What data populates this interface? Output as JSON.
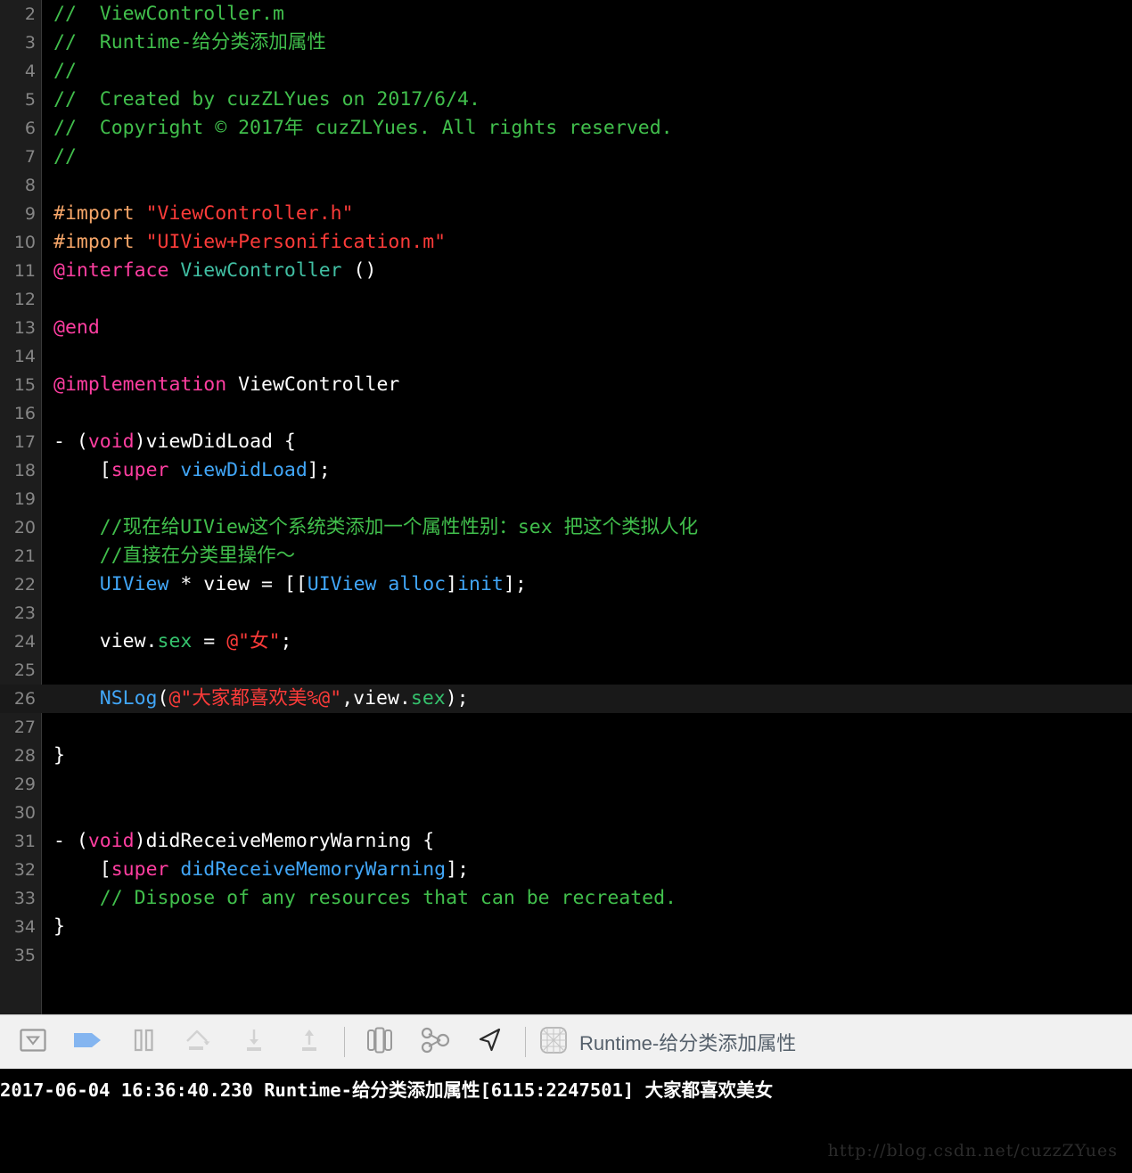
{
  "editor": {
    "first_visible_line": 2,
    "highlighted_line": 26,
    "lines": [
      {
        "n": "2",
        "tokens": [
          {
            "t": "//  ViewController.m",
            "c": "c-comment"
          }
        ]
      },
      {
        "n": "3",
        "tokens": [
          {
            "t": "//  Runtime-给分类添加属性",
            "c": "c-comment"
          }
        ]
      },
      {
        "n": "4",
        "tokens": [
          {
            "t": "//",
            "c": "c-comment"
          }
        ]
      },
      {
        "n": "5",
        "tokens": [
          {
            "t": "//  Created by cuzZLYues on 2017/6/4.",
            "c": "c-comment"
          }
        ]
      },
      {
        "n": "6",
        "tokens": [
          {
            "t": "//  Copyright © 2017年 cuzZLYues. All rights reserved.",
            "c": "c-comment"
          }
        ]
      },
      {
        "n": "7",
        "tokens": [
          {
            "t": "//",
            "c": "c-comment"
          }
        ]
      },
      {
        "n": "8",
        "tokens": []
      },
      {
        "n": "9",
        "tokens": [
          {
            "t": "#import ",
            "c": "c-pre"
          },
          {
            "t": "\"ViewController.h\"",
            "c": "c-string"
          }
        ]
      },
      {
        "n": "10",
        "tokens": [
          {
            "t": "#import ",
            "c": "c-pre"
          },
          {
            "t": "\"UIView+Personification.m\"",
            "c": "c-string"
          }
        ]
      },
      {
        "n": "11",
        "tokens": [
          {
            "t": "@interface ",
            "c": "c-key"
          },
          {
            "t": "ViewController",
            "c": "c-type"
          },
          {
            "t": " ()",
            "c": "c-plain"
          }
        ]
      },
      {
        "n": "12",
        "tokens": []
      },
      {
        "n": "13",
        "tokens": [
          {
            "t": "@end",
            "c": "c-key"
          }
        ]
      },
      {
        "n": "14",
        "tokens": []
      },
      {
        "n": "15",
        "tokens": [
          {
            "t": "@implementation ",
            "c": "c-key"
          },
          {
            "t": "ViewController",
            "c": "c-plain"
          }
        ]
      },
      {
        "n": "16",
        "tokens": []
      },
      {
        "n": "17",
        "tokens": [
          {
            "t": "- (",
            "c": "c-plain"
          },
          {
            "t": "void",
            "c": "c-key"
          },
          {
            "t": ")viewDidLoad {",
            "c": "c-plain"
          }
        ]
      },
      {
        "n": "18",
        "tokens": [
          {
            "t": "    [",
            "c": "c-plain"
          },
          {
            "t": "super ",
            "c": "c-key"
          },
          {
            "t": "viewDidLoad",
            "c": "c-method"
          },
          {
            "t": "];",
            "c": "c-plain"
          }
        ]
      },
      {
        "n": "19",
        "tokens": []
      },
      {
        "n": "20",
        "tokens": [
          {
            "t": "    //现在给UIView这个系统类添加一个属性性别：sex 把这个类拟人化",
            "c": "c-comment"
          }
        ]
      },
      {
        "n": "21",
        "tokens": [
          {
            "t": "    //直接在分类里操作～",
            "c": "c-comment"
          }
        ]
      },
      {
        "n": "22",
        "tokens": [
          {
            "t": "    ",
            "c": "c-plain"
          },
          {
            "t": "UIView",
            "c": "c-class"
          },
          {
            "t": " * view = [[",
            "c": "c-plain"
          },
          {
            "t": "UIView alloc",
            "c": "c-class"
          },
          {
            "t": "]",
            "c": "c-plain"
          },
          {
            "t": "init",
            "c": "c-class"
          },
          {
            "t": "];",
            "c": "c-plain"
          }
        ]
      },
      {
        "n": "23",
        "tokens": []
      },
      {
        "n": "24",
        "tokens": [
          {
            "t": "    view.",
            "c": "c-plain"
          },
          {
            "t": "sex",
            "c": "c-prop"
          },
          {
            "t": " = ",
            "c": "c-plain"
          },
          {
            "t": "@\"女\"",
            "c": "c-string"
          },
          {
            "t": ";",
            "c": "c-plain"
          }
        ]
      },
      {
        "n": "25",
        "tokens": []
      },
      {
        "n": "26",
        "tokens": [
          {
            "t": "    ",
            "c": "c-plain"
          },
          {
            "t": "NSLog",
            "c": "c-class"
          },
          {
            "t": "(",
            "c": "c-plain"
          },
          {
            "t": "@\"大家都喜欢美%@\"",
            "c": "c-string"
          },
          {
            "t": ",view.",
            "c": "c-plain"
          },
          {
            "t": "sex",
            "c": "c-prop"
          },
          {
            "t": ");",
            "c": "c-plain"
          }
        ]
      },
      {
        "n": "27",
        "tokens": []
      },
      {
        "n": "28",
        "tokens": [
          {
            "t": "}",
            "c": "c-plain"
          }
        ]
      },
      {
        "n": "29",
        "tokens": []
      },
      {
        "n": "30",
        "tokens": []
      },
      {
        "n": "31",
        "tokens": [
          {
            "t": "- (",
            "c": "c-plain"
          },
          {
            "t": "void",
            "c": "c-key"
          },
          {
            "t": ")didReceiveMemoryWarning {",
            "c": "c-plain"
          }
        ]
      },
      {
        "n": "32",
        "tokens": [
          {
            "t": "    [",
            "c": "c-plain"
          },
          {
            "t": "super ",
            "c": "c-key"
          },
          {
            "t": "didReceiveMemoryWarning",
            "c": "c-method"
          },
          {
            "t": "];",
            "c": "c-plain"
          }
        ]
      },
      {
        "n": "33",
        "tokens": [
          {
            "t": "    // Dispose of any resources that can be recreated.",
            "c": "c-comment"
          }
        ]
      },
      {
        "n": "34",
        "tokens": [
          {
            "t": "}",
            "c": "c-plain"
          }
        ]
      },
      {
        "n": "35",
        "tokens": []
      }
    ]
  },
  "toolbar": {
    "buttons": [
      {
        "name": "hide-debug-area-icon",
        "label": "Hide Debug Area"
      },
      {
        "name": "continue-icon",
        "label": "Continue program execution"
      },
      {
        "name": "pause-icon",
        "label": "Pause"
      },
      {
        "name": "step-over-icon",
        "label": "Step over"
      },
      {
        "name": "step-into-icon",
        "label": "Step into"
      },
      {
        "name": "step-out-icon",
        "label": "Step out"
      },
      {
        "name": "view-hierarchy-icon",
        "label": "Debug View Hierarchy"
      },
      {
        "name": "memory-graph-icon",
        "label": "Debug Memory Graph"
      },
      {
        "name": "simulate-location-icon",
        "label": "Simulate Location"
      }
    ],
    "breadcrumb_label": "Runtime-给分类添加属性",
    "accent_color": "#84b5f0"
  },
  "console": {
    "output": "2017-06-04 16:36:40.230 Runtime-给分类添加属性[6115:2247501] 大家都喜欢美女",
    "watermark": "http://blog.csdn.net/cuzzZYues"
  }
}
